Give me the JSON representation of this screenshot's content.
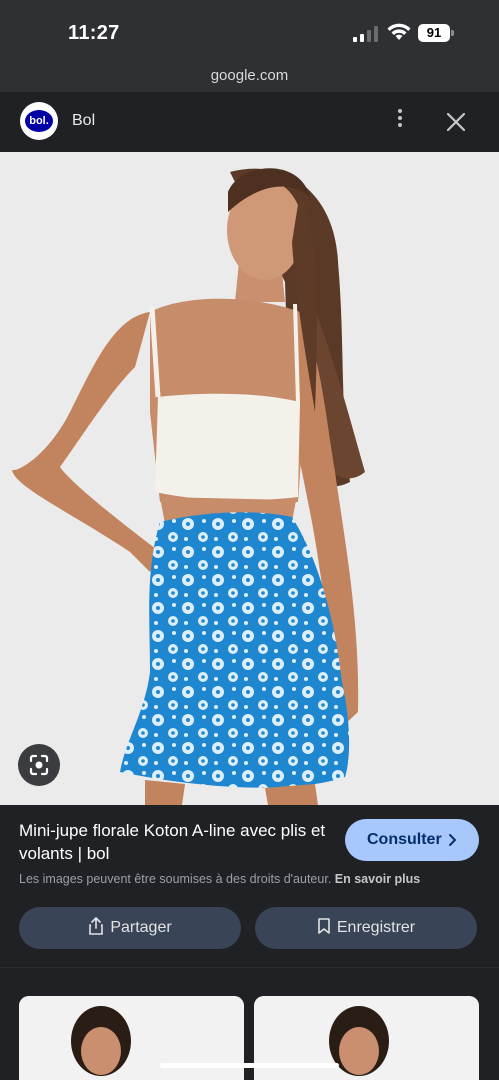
{
  "status_bar": {
    "time": "11:27",
    "battery": "91",
    "icons": [
      "cellular-signal-icon",
      "wifi-icon",
      "battery-icon"
    ]
  },
  "browser": {
    "url": "google.com"
  },
  "source": {
    "logo_text": "bol.",
    "name": "Bol",
    "menu_icon": "more-vertical-icon",
    "close_icon": "close-icon"
  },
  "image": {
    "lens_icon": "google-lens-icon"
  },
  "result": {
    "title": "Mini-jupe florale Koton A-line avec plis et volants | bol",
    "consult_label": "Consulter",
    "copyright_text": "Les images peuvent être soumises à des droits d'auteur.",
    "learn_more": "En savoir plus",
    "share_label": "Partager",
    "save_label": "Enregistrer"
  },
  "colors": {
    "accent_button": "#a8c7fa",
    "action_button": "#394457",
    "panel_bg": "#1f2124",
    "skirt_blue": "#1f87cf",
    "brand_blue": "#0000a4"
  }
}
